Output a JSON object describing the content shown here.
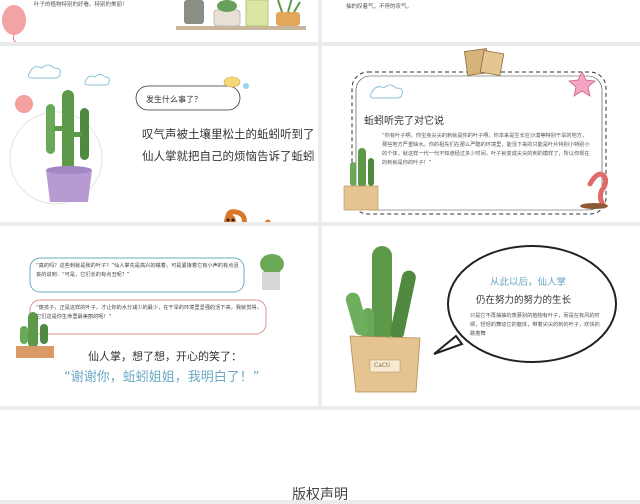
{
  "slide1": {
    "caption": "叶子的植物特别的好看。特别的美丽！"
  },
  "slide2": {
    "caption": "抽的叹着气，不停的叹气。"
  },
  "slide3": {
    "bubble": "发生什么事了？",
    "line1": "叹气声被土壤里松土的蚯蚓听到了",
    "line2": "仙人掌就把自己的烦恼告诉了蚯蚓"
  },
  "slide4": {
    "title": "蚯蚓听完了对它说",
    "body": "“你有叶子啊，你宝身尖尖的刺就是你的叶子啊。你本来是生长在沙漠等特别干旱的地方，那些地方严重缺水。你的祖先们在那么严酷的环境里，能活下来的只能是叶片特别小特别小的个体，就这样一代一代不知道经过多少时间，叶子就变成尖尖的刺的模样了，所以你现在的刺就是你的叶子！”"
  },
  "slide5": {
    "q1": "“真的吗？这些刺就是我的叶子？”仙人掌先是高兴的嘴着，可是紧接着它有小声的有点沮丧的说到：“可是，它们长的有点丑呢？”",
    "q2": "“傻孩子，正是这样的叶子，才让你的水分减少的最少，在干旱的环境里坚强的活下来，我就觉得，它们这是你生命里最美丽的呢！”",
    "line1": "仙人掌，想了想，开心的笑了：",
    "line2": "“谢谢你，蚯蚓姐姐，我明白了！”",
    "pot_label": "CaCti"
  },
  "slide6": {
    "line1": "从此以后，仙人掌",
    "line2": "仍在努力的努力的生长",
    "body": "只是它不再抽抽的羡慕别的植物有叶子，而是在有风的时候，轻轻的舞动它的躯体，带着尖尖的刺的叶子，欢快的跳着舞",
    "pot_label": "CaCti"
  },
  "footer": {
    "title": "版权声明"
  },
  "colors": {
    "accent_blue": "#6aa8c4",
    "cactus": "#5c9a4a",
    "pot_purple": "#b79ad1",
    "pot_tan": "#e6c491",
    "worm": "#d9782a",
    "text_dark": "#333333"
  }
}
